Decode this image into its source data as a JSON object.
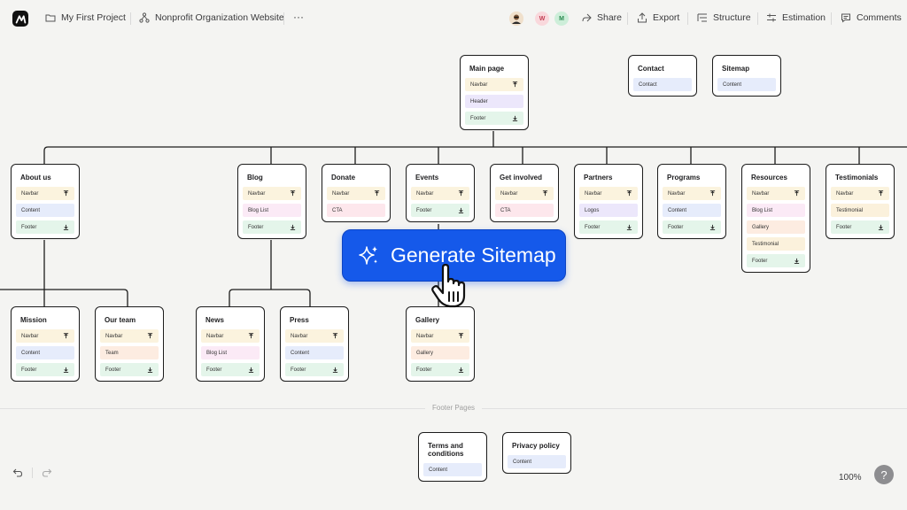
{
  "header": {
    "project": "My First Project",
    "site": "Nonprofit Organization Website",
    "more": "···",
    "avatars": [
      {
        "initial": "W",
        "color": "#f9d8dc",
        "text_color": "#c23d52"
      },
      {
        "initial": "M",
        "color": "#cdeed9",
        "text_color": "#2a8a4f"
      }
    ],
    "actions": {
      "share": "Share",
      "export": "Export",
      "structure": "Structure",
      "estimation": "Estimation",
      "comments": "Comments"
    }
  },
  "cards": {
    "main": {
      "title": "Main page",
      "blocks": [
        "Navbar",
        "Header",
        "Footer"
      ]
    },
    "contact": {
      "title": "Contact",
      "blocks": [
        "Contact"
      ]
    },
    "sitemap": {
      "title": "Sitemap",
      "blocks": [
        "Content"
      ]
    },
    "about": {
      "title": "About us",
      "blocks": [
        "Navbar",
        "Content",
        "Footer"
      ]
    },
    "blog": {
      "title": "Blog",
      "blocks": [
        "Navbar",
        "Blog List",
        "Footer"
      ]
    },
    "donate": {
      "title": "Donate",
      "blocks": [
        "Navbar",
        "CTA"
      ]
    },
    "events": {
      "title": "Events",
      "blocks": [
        "Navbar",
        "Footer"
      ]
    },
    "involved": {
      "title": "Get involved",
      "blocks": [
        "Navbar",
        "CTA"
      ]
    },
    "partners": {
      "title": "Partners",
      "blocks": [
        "Navbar",
        "Logos",
        "Footer"
      ]
    },
    "programs": {
      "title": "Programs",
      "blocks": [
        "Navbar",
        "Content",
        "Footer"
      ]
    },
    "resources": {
      "title": "Resources",
      "blocks": [
        "Navbar",
        "Blog List",
        "Gallery",
        "Testimonial",
        "Footer"
      ]
    },
    "testimonials": {
      "title": "Testimonials",
      "blocks": [
        "Navbar",
        "Testimonial",
        "Footer"
      ]
    },
    "mission": {
      "title": "Mission",
      "blocks": [
        "Navbar",
        "Content",
        "Footer"
      ]
    },
    "team": {
      "title": "Our team",
      "blocks": [
        "Navbar",
        "Team",
        "Footer"
      ]
    },
    "news": {
      "title": "News",
      "blocks": [
        "Navbar",
        "Blog List",
        "Footer"
      ]
    },
    "press": {
      "title": "Press",
      "blocks": [
        "Navbar",
        "Content",
        "Footer"
      ]
    },
    "gallery": {
      "title": "Gallery",
      "blocks": [
        "Navbar",
        "Gallery",
        "Footer"
      ]
    },
    "terms": {
      "title": "Terms and conditions",
      "blocks": [
        "Content"
      ]
    },
    "privacy": {
      "title": "Privacy policy",
      "blocks": [
        "Content"
      ]
    }
  },
  "footer_section_label": "Footer Pages",
  "generate_button": "Generate Sitemap",
  "zoom": "100%",
  "help": "?"
}
